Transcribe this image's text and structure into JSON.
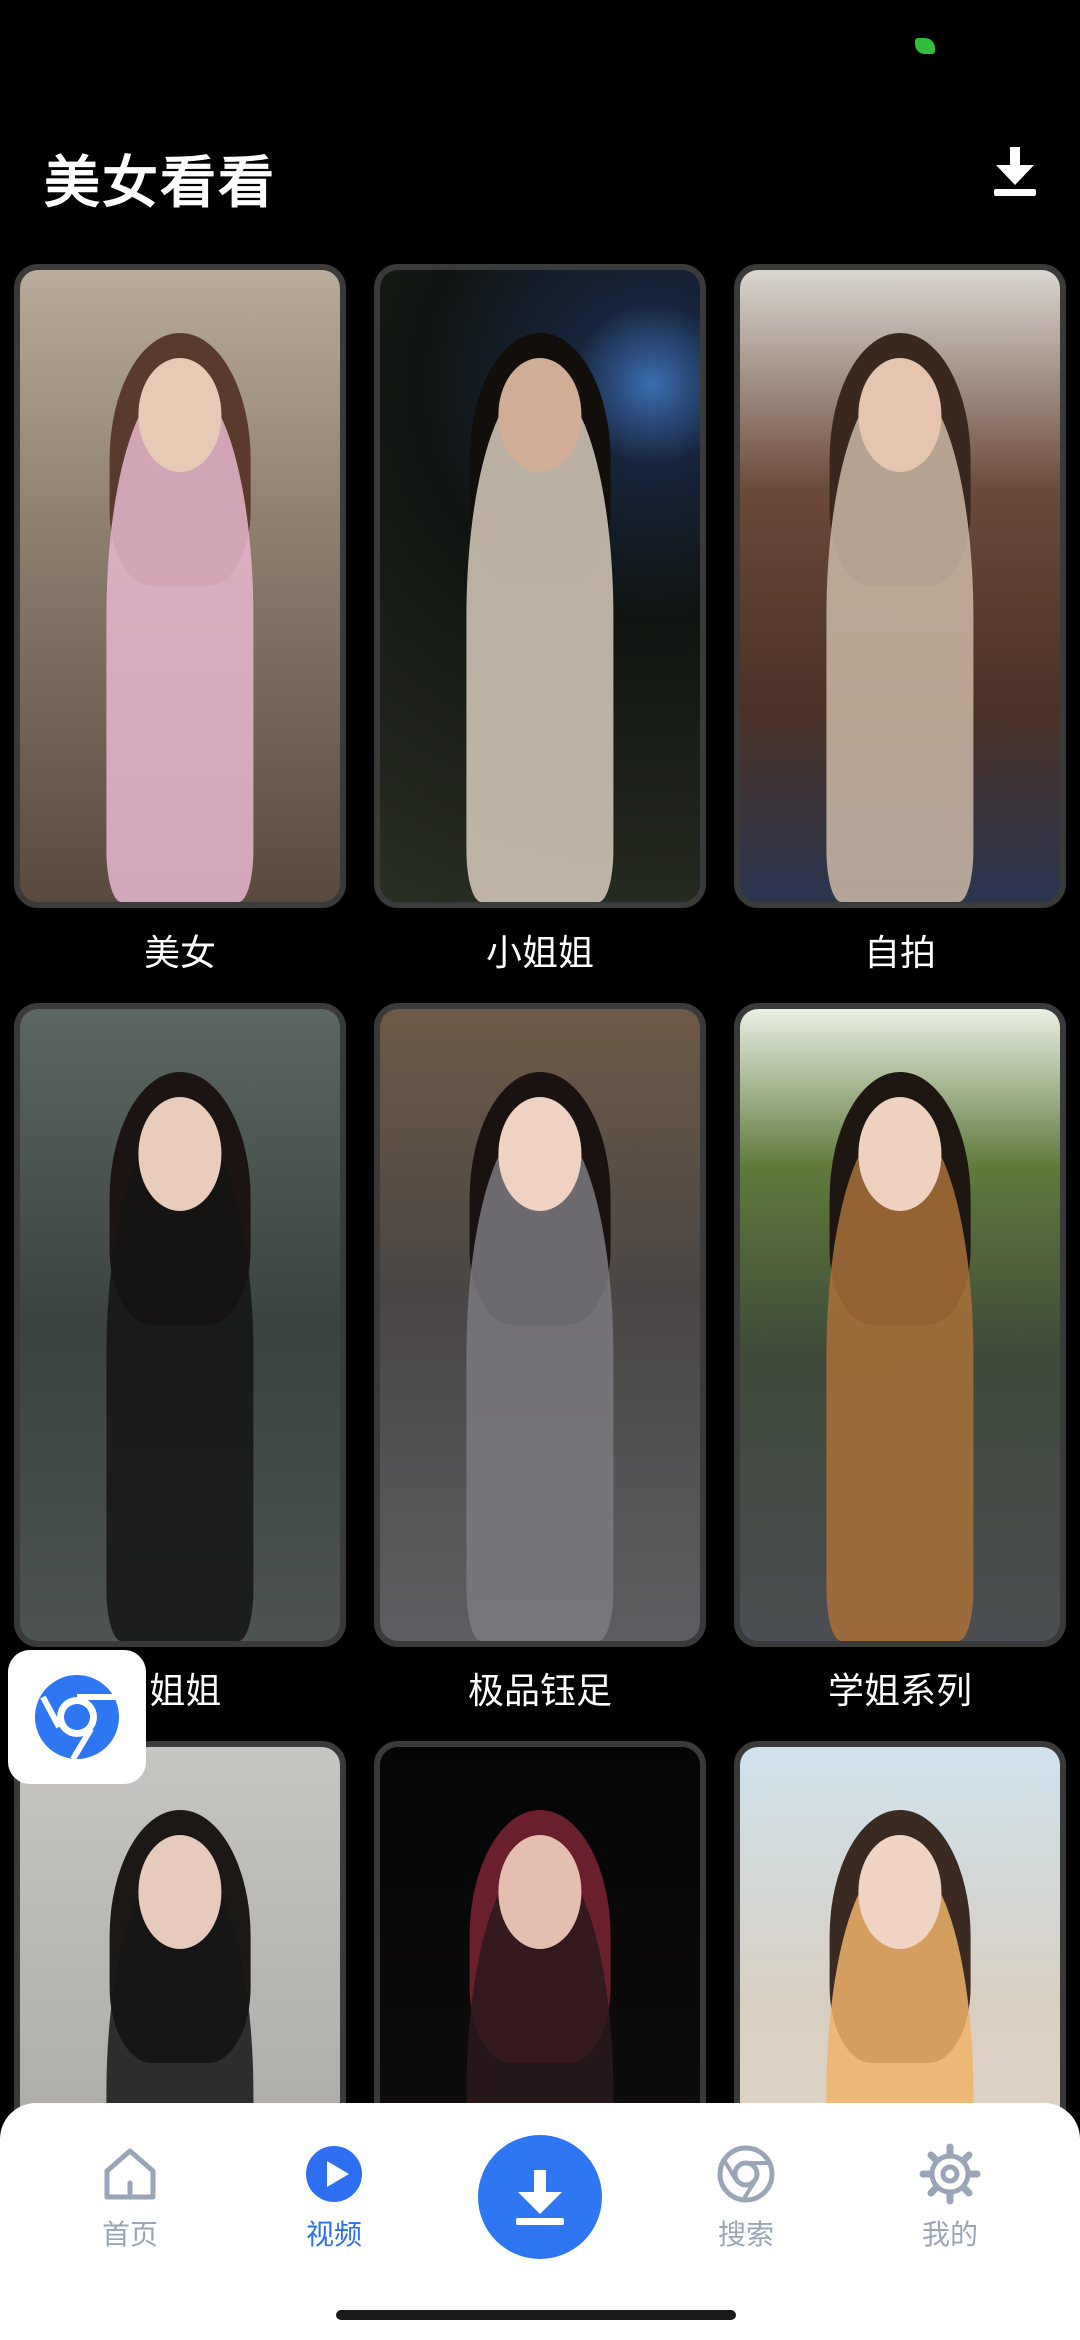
{
  "app": {
    "title": "美女看看"
  },
  "grid": {
    "items": [
      {
        "label": "美女"
      },
      {
        "label": "小姐姐"
      },
      {
        "label": "自拍"
      },
      {
        "label": "J姐姐"
      },
      {
        "label": "极品钰足"
      },
      {
        "label": "学姐系列"
      },
      {
        "label": ""
      },
      {
        "label": ""
      },
      {
        "label": ""
      }
    ]
  },
  "icons": {
    "header_download": "download-icon",
    "floating": "chrome-icon",
    "home": "home-icon",
    "video": "play-icon",
    "center": "download-icon",
    "search": "chrome-icon",
    "settings": "gear-icon"
  },
  "nav": {
    "items": [
      {
        "label": "首页"
      },
      {
        "label": "视频"
      },
      {
        "label": "搜索"
      },
      {
        "label": "我的"
      }
    ],
    "active_index": 1
  },
  "colors": {
    "background": "#000000",
    "accent": "#2f76f3",
    "nav_inactive": "#9aa6b8",
    "nav_active": "#2e6ff2"
  }
}
